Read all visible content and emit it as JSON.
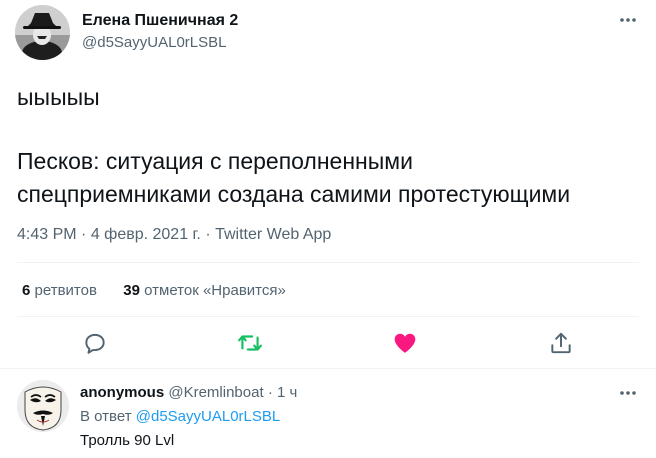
{
  "tweet": {
    "author_name": "Елена Пшеничная 2",
    "author_handle": "@d5SayyUAL0rLSBL",
    "text_line1": "ыыыыы",
    "text_line2": "Песков: ситуация с переполненными",
    "text_line3": "спецприемниками создана самими протестующими",
    "time": "4:43 PM",
    "sep1": " · ",
    "date": "4 февр. 2021 г.",
    "sep2": " · ",
    "source": "Twitter Web App",
    "retweets_count": "6",
    "retweets_label": "ретвитов",
    "likes_count": "39",
    "likes_label": "отметок «Нравится»"
  },
  "reply": {
    "author_name": "anonymous",
    "author_handle": "@Kremlinboat",
    "time": "· 1 ч",
    "reply_to_prefix": "В ответ",
    "reply_to_handle": "@d5SayyUAL0rLSBL",
    "text": "Тролль 90 Lvl"
  },
  "icons": {
    "reply": "comment-icon",
    "retweet": "retweet-icon",
    "like": "heart-icon",
    "share": "share-icon",
    "more": "more-icon"
  },
  "colors": {
    "retweet": "#17bf63",
    "like": "#f91880",
    "link": "#1d9bf0",
    "secondary_text": "#536471"
  }
}
